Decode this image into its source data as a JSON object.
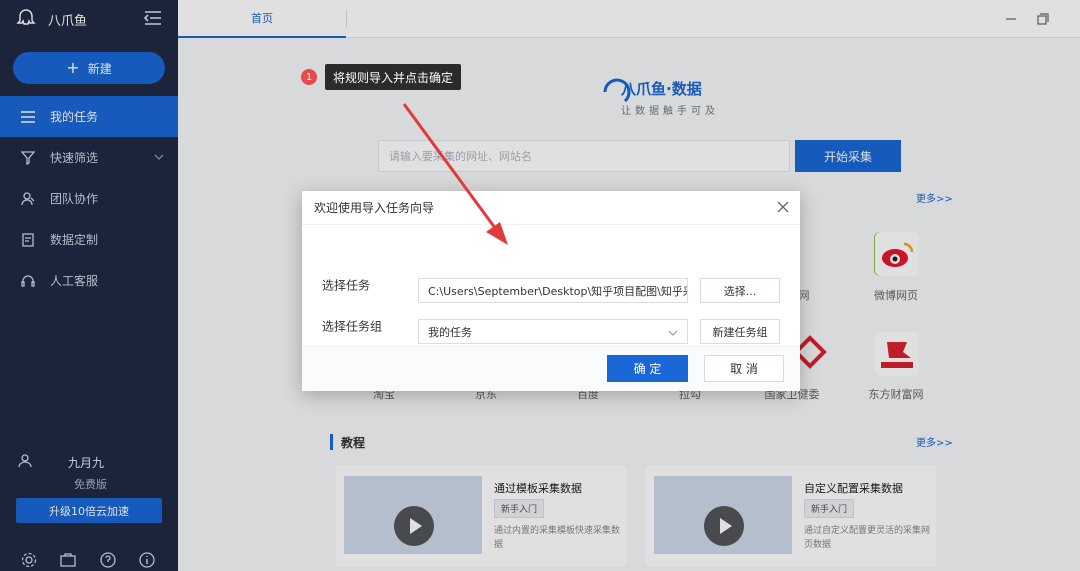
{
  "app": {
    "name": "八爪鱼"
  },
  "sidebar": {
    "new_label": "新建",
    "items": [
      {
        "label": "我的任务",
        "icon": "list-icon"
      },
      {
        "label": "快速筛选",
        "icon": "filter-icon"
      },
      {
        "label": "团队协作",
        "icon": "team-icon"
      },
      {
        "label": "数据定制",
        "icon": "document-icon"
      },
      {
        "label": "人工客服",
        "icon": "headset-icon"
      }
    ],
    "user": {
      "name": "九月九",
      "plan": "免费版"
    },
    "upgrade_label": "升级10倍云加速"
  },
  "tabs": {
    "home_label": "首页"
  },
  "callout": {
    "step": "1",
    "text": "将规则导入并点击确定"
  },
  "brand": {
    "name": "八爪鱼·数据",
    "slogan": "让数据触手可及"
  },
  "search": {
    "placeholder": "请输入要采集的网址、网站名"
  },
  "start_label": "开始采集",
  "more_label": "更多>>",
  "sites": [
    {
      "label": "微博网页"
    },
    {
      "label": "东方财富网"
    },
    {
      "label": "淘宝"
    },
    {
      "label": "京东"
    },
    {
      "label": "百度"
    },
    {
      "label": "拉勾"
    },
    {
      "label": "国家卫健委"
    },
    {
      "label": "网"
    }
  ],
  "tutorial": {
    "section_title": "教程",
    "cards": [
      {
        "title": "通过模板采集数据",
        "tag": "新手入门",
        "desc": "通过内置的采集模板快速采集数据"
      },
      {
        "title": "自定义配置采集数据",
        "tag": "新手入门",
        "desc": "通过自定义配置更灵活的采集网页数据"
      }
    ]
  },
  "dialog": {
    "title": "欢迎使用导入任务向导",
    "task_label": "选择任务",
    "task_path": "C:\\Users\\September\\Desktop\\知乎项目配图\\知乎采",
    "choose_label": "选择...",
    "group_label": "选择任务组",
    "group_value": "我的任务",
    "new_group_label": "新建任务组",
    "ok_label": "确 定",
    "cancel_label": "取 消"
  },
  "colors": {
    "accent": "#1a67d6",
    "sidebar_bg": "#1f2a44",
    "badge": "#e84a4a",
    "arrow": "#e23a3a"
  }
}
